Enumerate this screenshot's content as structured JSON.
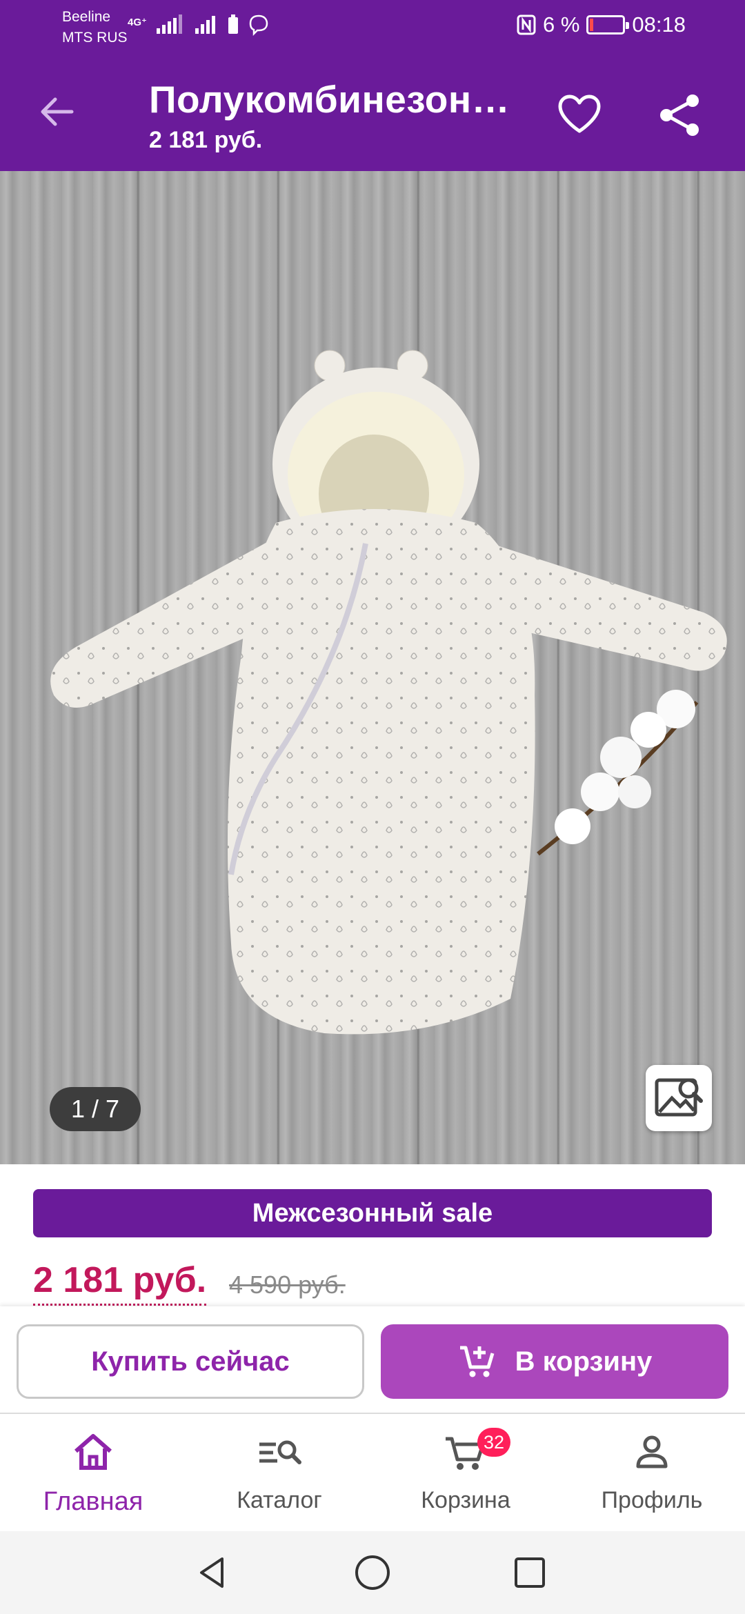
{
  "status": {
    "carrier1": "Beeline",
    "carrier2": "MTS RUS",
    "network": "4G⁺",
    "battery": "6 %",
    "time": "08:18"
  },
  "app_bar": {
    "title": "Полукомбинезон…",
    "subtitle": "2 181 руб."
  },
  "gallery": {
    "counter": "1 / 7"
  },
  "product": {
    "sale_label": "Межсезонный sale",
    "price": "2 181 руб.",
    "old_price": "4 590 руб."
  },
  "actions": {
    "buy_now": "Купить сейчас",
    "to_cart": "В корзину"
  },
  "nav": {
    "home": "Главная",
    "catalog": "Каталог",
    "cart": "Корзина",
    "cart_badge": "32",
    "profile": "Профиль"
  },
  "colors": {
    "brand": "#6a1b9a",
    "accent": "#ab47bc",
    "price": "#c2185b"
  }
}
